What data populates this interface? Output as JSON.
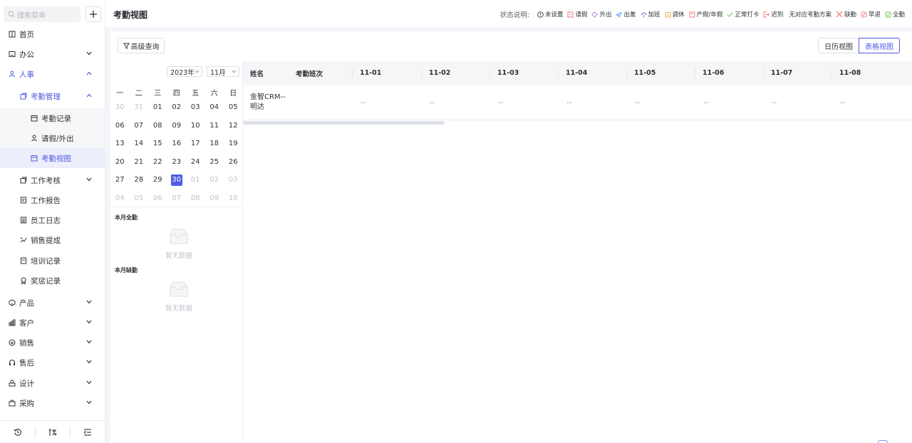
{
  "sidebar": {
    "search_placeholder": "搜索菜单",
    "items": [
      {
        "label": "首页",
        "icon": "home-icon"
      },
      {
        "label": "办公",
        "icon": "office-icon"
      },
      {
        "label": "人事",
        "icon": "people-icon"
      },
      {
        "label": "考勤管理",
        "icon": "attendance-icon"
      },
      {
        "label": "考勤记录",
        "icon": "calendar-icon"
      },
      {
        "label": "请假/外出",
        "icon": "person-icon"
      },
      {
        "label": "考勤视图",
        "icon": "calendar-view-icon"
      },
      {
        "label": "工作考核",
        "icon": "copy-icon"
      },
      {
        "label": "工作报告",
        "icon": "report-icon"
      },
      {
        "label": "员工日志",
        "icon": "log-icon"
      },
      {
        "label": "销售提成",
        "icon": "commission-icon"
      },
      {
        "label": "培训记录",
        "icon": "training-icon"
      },
      {
        "label": "奖惩记录",
        "icon": "award-icon"
      },
      {
        "label": "产品",
        "icon": "product-icon"
      },
      {
        "label": "客户",
        "icon": "customer-icon"
      },
      {
        "label": "销售",
        "icon": "sales-icon"
      },
      {
        "label": "售后",
        "icon": "headset-icon"
      },
      {
        "label": "设计",
        "icon": "design-icon"
      },
      {
        "label": "采购",
        "icon": "purchase-icon"
      }
    ]
  },
  "header": {
    "title": "考勤视图",
    "legend_label": "状态说明:",
    "legend": [
      {
        "label": "未设置",
        "icon": "info-circle-icon",
        "color": "#303133"
      },
      {
        "label": "请假",
        "icon": "leave-icon",
        "color": "#f56c6c"
      },
      {
        "label": "外出",
        "icon": "out-icon",
        "color": "#b37feb"
      },
      {
        "label": "出差",
        "icon": "plane-icon",
        "color": "#409eff"
      },
      {
        "label": "加班",
        "icon": "overtime-icon",
        "color": "#4f5be3"
      },
      {
        "label": "调休",
        "icon": "rest-icon",
        "color": "#e6a23c"
      },
      {
        "label": "产假/年假",
        "icon": "maternity-icon",
        "color": "#f56c6c"
      },
      {
        "label": "正常打卡",
        "icon": "check-icon",
        "color": "#67c23a"
      },
      {
        "label": "迟到",
        "icon": "late-icon",
        "color": "#f56c6c"
      },
      {
        "label": "无对应考勤方案",
        "icon": "",
        "color": "#303133"
      },
      {
        "label": "缺勤",
        "icon": "cross-icon",
        "color": "#f56c6c"
      },
      {
        "label": "早退",
        "icon": "early-leave-icon",
        "color": "#f56c6c"
      },
      {
        "label": "全勤",
        "icon": "full-icon",
        "color": "#67c23a"
      }
    ]
  },
  "toolbar": {
    "advanced_query": "高级查询",
    "calendar_view": "日历视图",
    "table_view": "表格视图"
  },
  "calendar": {
    "year": "2023年",
    "month": "11月",
    "weekdays": [
      "一",
      "二",
      "三",
      "四",
      "五",
      "六",
      "日"
    ],
    "weeks": [
      [
        {
          "d": "30",
          "m": 0
        },
        {
          "d": "31",
          "m": 0
        },
        {
          "d": "01",
          "m": 1
        },
        {
          "d": "02",
          "m": 1
        },
        {
          "d": "03",
          "m": 1
        },
        {
          "d": "04",
          "m": 1
        },
        {
          "d": "05",
          "m": 1
        }
      ],
      [
        {
          "d": "06",
          "m": 1
        },
        {
          "d": "07",
          "m": 1
        },
        {
          "d": "08",
          "m": 1
        },
        {
          "d": "09",
          "m": 1
        },
        {
          "d": "10",
          "m": 1
        },
        {
          "d": "11",
          "m": 1
        },
        {
          "d": "12",
          "m": 1
        }
      ],
      [
        {
          "d": "13",
          "m": 1
        },
        {
          "d": "14",
          "m": 1
        },
        {
          "d": "15",
          "m": 1
        },
        {
          "d": "16",
          "m": 1
        },
        {
          "d": "17",
          "m": 1
        },
        {
          "d": "18",
          "m": 1
        },
        {
          "d": "19",
          "m": 1
        }
      ],
      [
        {
          "d": "20",
          "m": 1
        },
        {
          "d": "21",
          "m": 1
        },
        {
          "d": "22",
          "m": 1
        },
        {
          "d": "23",
          "m": 1
        },
        {
          "d": "24",
          "m": 1
        },
        {
          "d": "25",
          "m": 1
        },
        {
          "d": "26",
          "m": 1
        }
      ],
      [
        {
          "d": "27",
          "m": 1
        },
        {
          "d": "28",
          "m": 1
        },
        {
          "d": "29",
          "m": 1
        },
        {
          "d": "30",
          "m": 1,
          "selected": true
        },
        {
          "d": "01",
          "m": 0
        },
        {
          "d": "02",
          "m": 0
        },
        {
          "d": "03",
          "m": 0
        }
      ],
      [
        {
          "d": "04",
          "m": 0
        },
        {
          "d": "05",
          "m": 0
        },
        {
          "d": "06",
          "m": 0
        },
        {
          "d": "07",
          "m": 0
        },
        {
          "d": "08",
          "m": 0
        },
        {
          "d": "09",
          "m": 0
        },
        {
          "d": "10",
          "m": 0
        }
      ]
    ],
    "full_attendance_title": "本月全勤",
    "absence_title": "本月缺勤",
    "empty_text": "暂无数据"
  },
  "table": {
    "columns": [
      "姓名",
      "考勤班次",
      "11-01",
      "11-02",
      "11-03",
      "11-04",
      "11-05",
      "11-06",
      "11-07",
      "11-08"
    ],
    "rows": [
      {
        "name": "金智CRM--明达",
        "shift": "",
        "cells": [
          "--",
          "--",
          "--",
          "--",
          "--",
          "--",
          "--",
          "--"
        ]
      }
    ]
  }
}
